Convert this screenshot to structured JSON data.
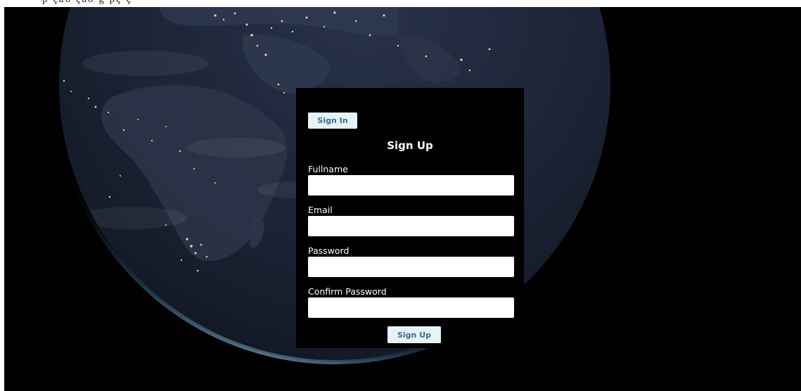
{
  "colors": {
    "page_background": "#000000",
    "button_background": "#e6f4f9",
    "button_text": "#3b6c86",
    "label_text": "#ffffff",
    "input_background": "#ffffff"
  },
  "top_strip": {
    "text": "p                                                                    ção                              ção                                     g                          pç  ç"
  },
  "header": {
    "sign_in_label": "Sign In"
  },
  "form": {
    "title": "Sign Up",
    "fields": [
      {
        "label": "Fullname",
        "value": "",
        "placeholder": ""
      },
      {
        "label": "Email",
        "value": "",
        "placeholder": ""
      },
      {
        "label": "Password",
        "value": "",
        "placeholder": ""
      },
      {
        "label": "Confirm Password",
        "value": "",
        "placeholder": ""
      }
    ],
    "submit_label": "Sign Up"
  },
  "background": {
    "image_description_icon": "earth-at-night-icon"
  }
}
